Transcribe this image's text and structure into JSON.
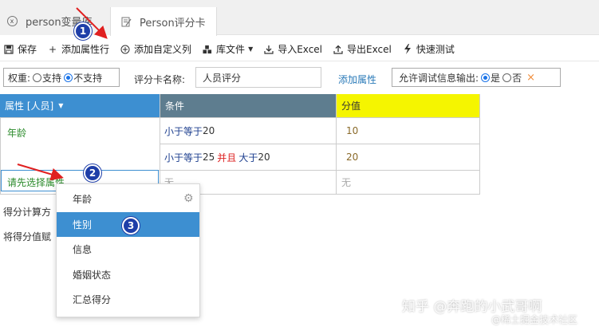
{
  "tabs": [
    {
      "label": "person变量库",
      "icon": "variable-icon"
    },
    {
      "label": "Person评分卡",
      "icon": "edit-doc-icon"
    }
  ],
  "toolbar": {
    "save": "保存",
    "add_attr_row": "添加属性行",
    "add_custom_col": "添加自定义列",
    "library": "库文件",
    "import_excel": "导入Excel",
    "export_excel": "导出Excel",
    "quick_test": "快速测试"
  },
  "options": {
    "weight_label": "权重:",
    "support": "支持",
    "not_support": "不支持",
    "weight_selected": "不支持",
    "card_name_label": "评分卡名称:",
    "card_name_value": "人员评分",
    "add_attribute_link": "添加属性",
    "debug_label": "允许调试信息输出:",
    "yes": "是",
    "no": "否",
    "debug_selected": "是",
    "clear_glyph": "×"
  },
  "grid": {
    "headers": {
      "attribute": "属性 [人员]",
      "condition": "条件",
      "score": "分值"
    },
    "rows": [
      {
        "attribute": "年龄",
        "conditions": [
          {
            "parts": [
              "小于等于",
              " 20"
            ],
            "score": "10"
          },
          {
            "parts": [
              "小于等于",
              " 25",
              "并且",
              "大于",
              " 20"
            ],
            "score": "20"
          }
        ]
      },
      {
        "attribute": "请先选择属性",
        "condition": "无",
        "score": "无"
      }
    ]
  },
  "below": {
    "line1": "得分计算方",
    "line2": "将得分值赋"
  },
  "dropdown": {
    "items": [
      "年龄",
      "性别",
      "信息",
      "婚姻状态",
      "汇总得分"
    ],
    "active": "性别"
  },
  "annotations": {
    "badge1": "1",
    "badge2": "2",
    "badge3": "3",
    "arrow_color": "#e02020"
  },
  "watermark": {
    "line1": "知乎 @奔跑的小武哥啊",
    "line2": "@稀土掘金技术社区"
  },
  "colors": {
    "attr_header": "#3d8fd1",
    "cond_header": "#5e7d8f",
    "score_header": "#f5f500",
    "badge": "#1e3ea8",
    "and_keyword": "#d22222"
  }
}
